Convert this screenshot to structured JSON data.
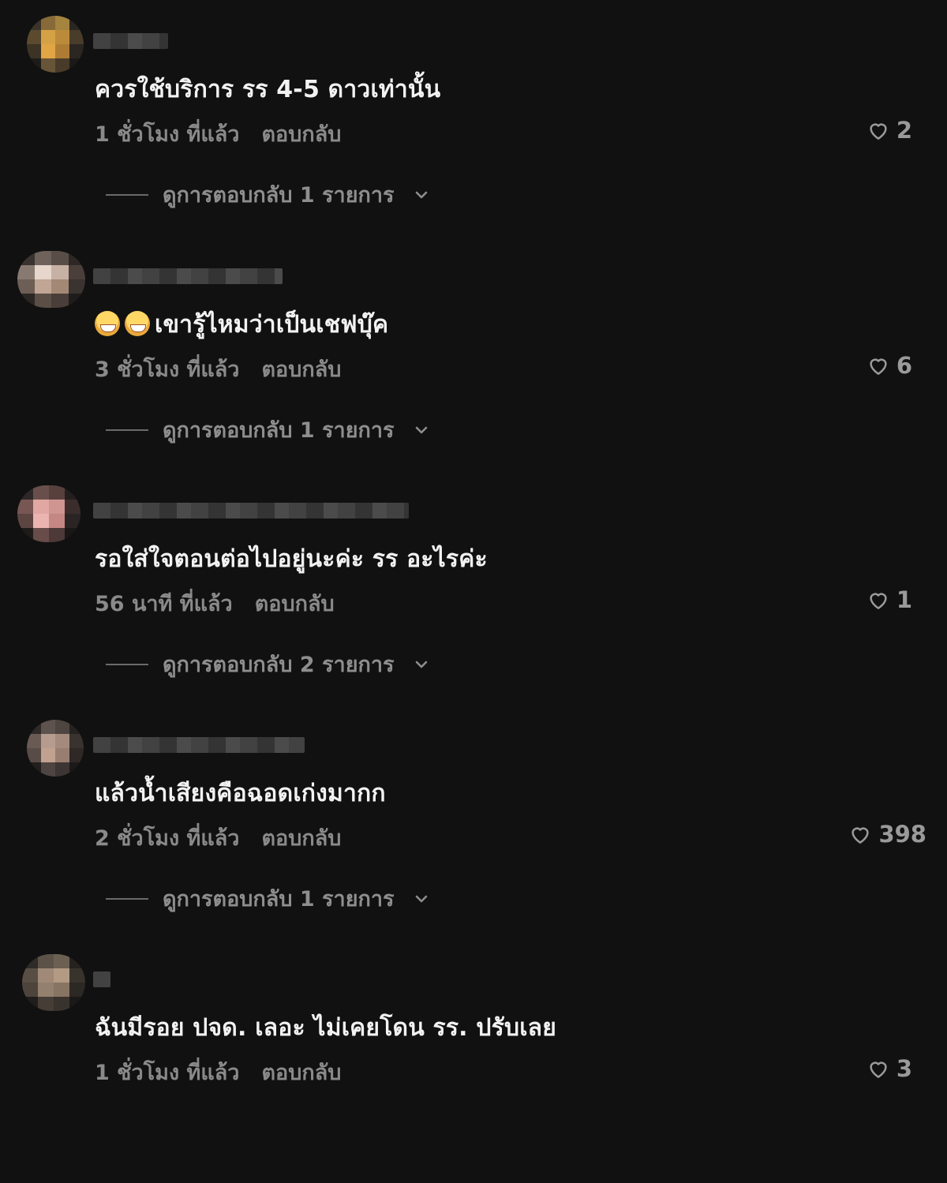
{
  "comments": [
    {
      "text": "ควรใช้บริการ รร 4-5 ดาวเท่านั้น",
      "time": "1 ชั่วโมง ที่แล้ว",
      "reply_label": "ตอบกลับ",
      "likes": "2",
      "view_replies": "ดูการตอบกลับ 1 รายการ"
    },
    {
      "text": "เขารู้ไหมว่าเป็นเชฟบุ๊ค",
      "emoji": [
        "grinning-face-icon",
        "grinning-face-icon"
      ],
      "time": "3 ชั่วโมง ที่แล้ว",
      "reply_label": "ตอบกลับ",
      "likes": "6",
      "view_replies": "ดูการตอบกลับ 1 รายการ"
    },
    {
      "text": "รอใส่ใจตอนต่อไปอยู่นะค่ะ รร อะไรค่ะ",
      "time": "56 นาที ที่แล้ว",
      "reply_label": "ตอบกลับ",
      "likes": "1",
      "view_replies": "ดูการตอบกลับ 2 รายการ"
    },
    {
      "text": "แล้วน้ำเสียงคือฉอดเก่งมากก",
      "time": "2 ชั่วโมง ที่แล้ว",
      "reply_label": "ตอบกลับ",
      "likes": "398",
      "view_replies": "ดูการตอบกลับ 1 รายการ"
    },
    {
      "text": "ฉันมีรอย ปจด. เลอะ ไม่เคยโดน รร. ปรับเลย",
      "time": "1 ชั่วโมง ที่แล้ว",
      "reply_label": "ตอบกลับ",
      "likes": "3"
    }
  ],
  "icons": {
    "like": "heart-icon",
    "expand": "chevron-down-icon"
  },
  "colors": {
    "background": "#111111",
    "text": "#f2f2f2",
    "meta": "#8a8a8a"
  }
}
